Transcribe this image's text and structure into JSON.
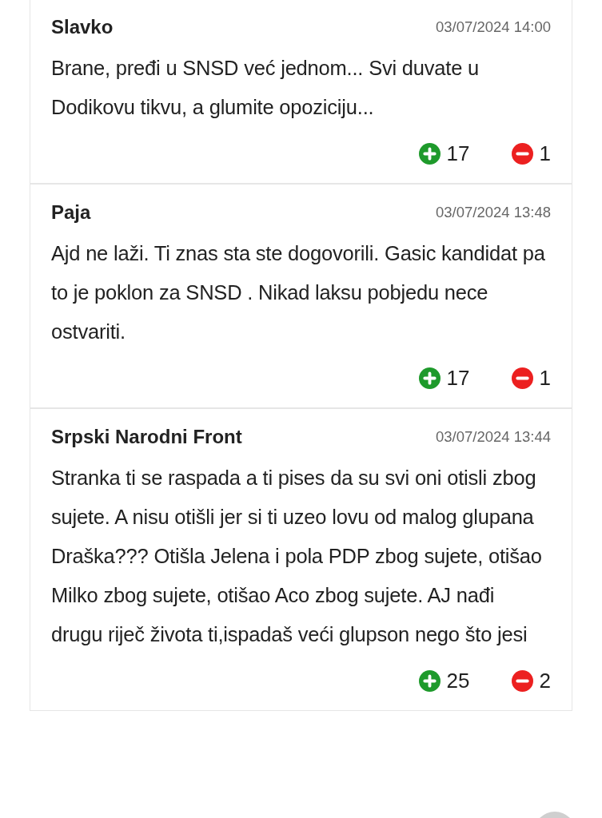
{
  "comments": [
    {
      "author": "Slavko",
      "date": "03/07/2024 14:00",
      "text": "Brane, pređi u SNSD već jednom... Svi duvate u Dodikovu tikvu, a glumite opoziciju...",
      "likes": "17",
      "dislikes": "1"
    },
    {
      "author": "Paja",
      "date": "03/07/2024 13:48",
      "text": "Ajd ne laži. Ti znas sta ste dogovorili. Gasic kandidat pa to je poklon za SNSD . Nikad laksu pobjedu nece ostvariti.",
      "likes": "17",
      "dislikes": "1"
    },
    {
      "author": "Srpski Narodni Front",
      "date": "03/07/2024 13:44",
      "text": "Stranka ti se raspada a ti pises da su svi oni otisli zbog sujete. A nisu otišli jer si ti uzeo lovu od malog glupana Draška??? Otišla Jelena i pola PDP zbog sujete, otišao Milko zbog sujete, otišao Aco zbog sujete. AJ nađi drugu riječ života ti,ispadaš veći glupson nego što jesi",
      "likes": "25",
      "dislikes": "2"
    }
  ]
}
